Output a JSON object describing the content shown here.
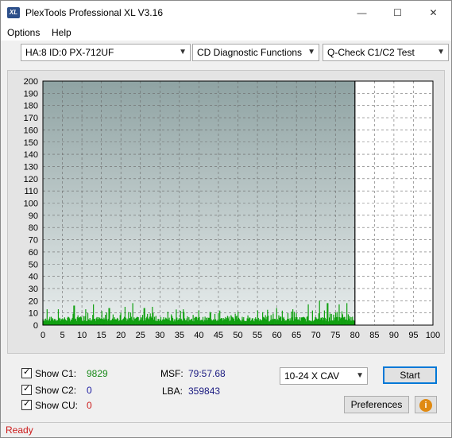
{
  "window": {
    "title": "PlexTools Professional XL V3.16",
    "icon_text": "XL",
    "min_icon": "minimize-icon",
    "max_icon": "maximize-icon",
    "close_icon": "close-icon"
  },
  "menu": {
    "options": "Options",
    "help": "Help"
  },
  "selectors": {
    "drive": "HA:8 ID:0  PX-712UF",
    "function": "CD Diagnostic Functions",
    "test": "Q-Check C1/C2 Test"
  },
  "chart_data": {
    "type": "bar",
    "x_ticks": [
      "0",
      "5",
      "10",
      "15",
      "20",
      "25",
      "30",
      "35",
      "40",
      "45",
      "50",
      "55",
      "60",
      "65",
      "70",
      "75",
      "80",
      "85",
      "90",
      "95",
      "100"
    ],
    "y_ticks": [
      "0",
      "10",
      "20",
      "30",
      "40",
      "50",
      "60",
      "70",
      "80",
      "90",
      "100",
      "110",
      "120",
      "130",
      "140",
      "150",
      "160",
      "170",
      "180",
      "190",
      "200"
    ],
    "xlim": [
      0,
      100
    ],
    "ylim": [
      0,
      200
    ],
    "grid": true,
    "marker_x": 80,
    "series": [
      {
        "color": "#10a010",
        "x_start": 0,
        "x_end": 80,
        "baseline": 3,
        "peaks": [
          {
            "x": 1,
            "y": 13
          },
          {
            "x": 4,
            "y": 13
          },
          {
            "x": 8,
            "y": 16
          },
          {
            "x": 11,
            "y": 13
          },
          {
            "x": 13,
            "y": 17
          },
          {
            "x": 17,
            "y": 14
          },
          {
            "x": 21,
            "y": 15
          },
          {
            "x": 23,
            "y": 18
          },
          {
            "x": 26,
            "y": 14
          },
          {
            "x": 28,
            "y": 15
          },
          {
            "x": 32,
            "y": 11
          },
          {
            "x": 36,
            "y": 13
          },
          {
            "x": 40,
            "y": 12
          },
          {
            "x": 45,
            "y": 10
          },
          {
            "x": 50,
            "y": 11
          },
          {
            "x": 55,
            "y": 12
          },
          {
            "x": 60,
            "y": 14
          },
          {
            "x": 64,
            "y": 13
          },
          {
            "x": 68,
            "y": 17
          },
          {
            "x": 71,
            "y": 20
          },
          {
            "x": 73,
            "y": 18
          },
          {
            "x": 76,
            "y": 17
          },
          {
            "x": 78,
            "y": 18
          }
        ]
      }
    ]
  },
  "stats": {
    "show_c1_label": "Show C1:",
    "c1_value": "9829",
    "show_c2_label": "Show C2:",
    "c2_value": "0",
    "show_cu_label": "Show CU:",
    "cu_value": "0",
    "msf_label": "MSF:",
    "msf_value": "79:57.68",
    "lba_label": "LBA:",
    "lba_value": "359843"
  },
  "controls": {
    "speed": "10-24 X CAV",
    "start": "Start",
    "preferences": "Preferences",
    "info": "i"
  },
  "status": "Ready"
}
